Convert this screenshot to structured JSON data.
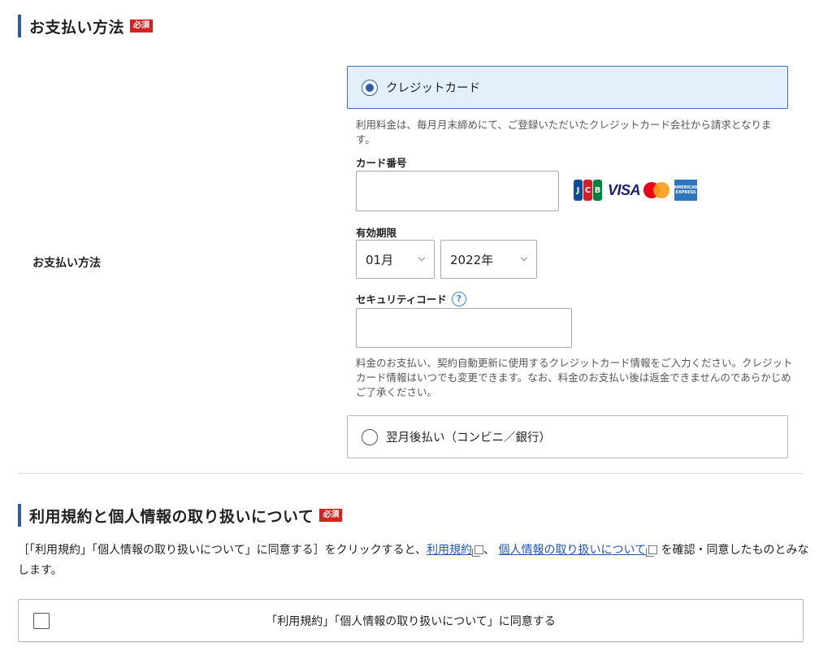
{
  "payment_section": {
    "title": "お支払い方法",
    "required_badge": "必須",
    "row_label": "お支払い方法",
    "credit_option": {
      "label": "クレジットカード",
      "selected": true,
      "note": "利用料金は、毎月月末締めにて、ご登録いただいたクレジットカード会社から請求となります。"
    },
    "card_number": {
      "label": "カード番号",
      "value": "",
      "placeholder": ""
    },
    "card_brands": [
      "JCB",
      "VISA",
      "Mastercard",
      "American Express"
    ],
    "jcb_letters": [
      "J",
      "C",
      "B"
    ],
    "visa_text": "VISA",
    "amex_text": [
      "AMERICAN",
      "EXPRESS"
    ],
    "expiry": {
      "label": "有効期限",
      "month": "01月",
      "year": "2022年"
    },
    "security_code": {
      "label": "セキュリティコード",
      "help": "?",
      "value": ""
    },
    "card_note": "料金のお支払い、契約自動更新に使用するクレジットカード情報をご入力ください。クレジットカード情報はいつでも変更できます。なお、料金のお支払い後は返金できませんのであらかじめご了承ください。",
    "deferred_option": {
      "label": "翌月後払い（コンビニ／銀行）",
      "selected": false
    }
  },
  "terms_section": {
    "title": "利用規約と個人情報の取り扱いについて",
    "required_badge": "必須",
    "text_before": "［「利用規約」「個人情報の取り扱いについて」に同意する］をクリックすると、",
    "link_terms": "利用規約",
    "separator": "、",
    "link_privacy": "個人情報の取り扱いについて",
    "text_after": "を確認・同意したものとみなします。",
    "agree_label": "「利用規約」「個人情報の取り扱いについて」に同意する",
    "agree_checked": false
  },
  "colors": {
    "accent_blue": "#2f5aa8",
    "required_red": "#d6221f",
    "selected_bg": "#e3effb",
    "link": "#1f56b3"
  }
}
